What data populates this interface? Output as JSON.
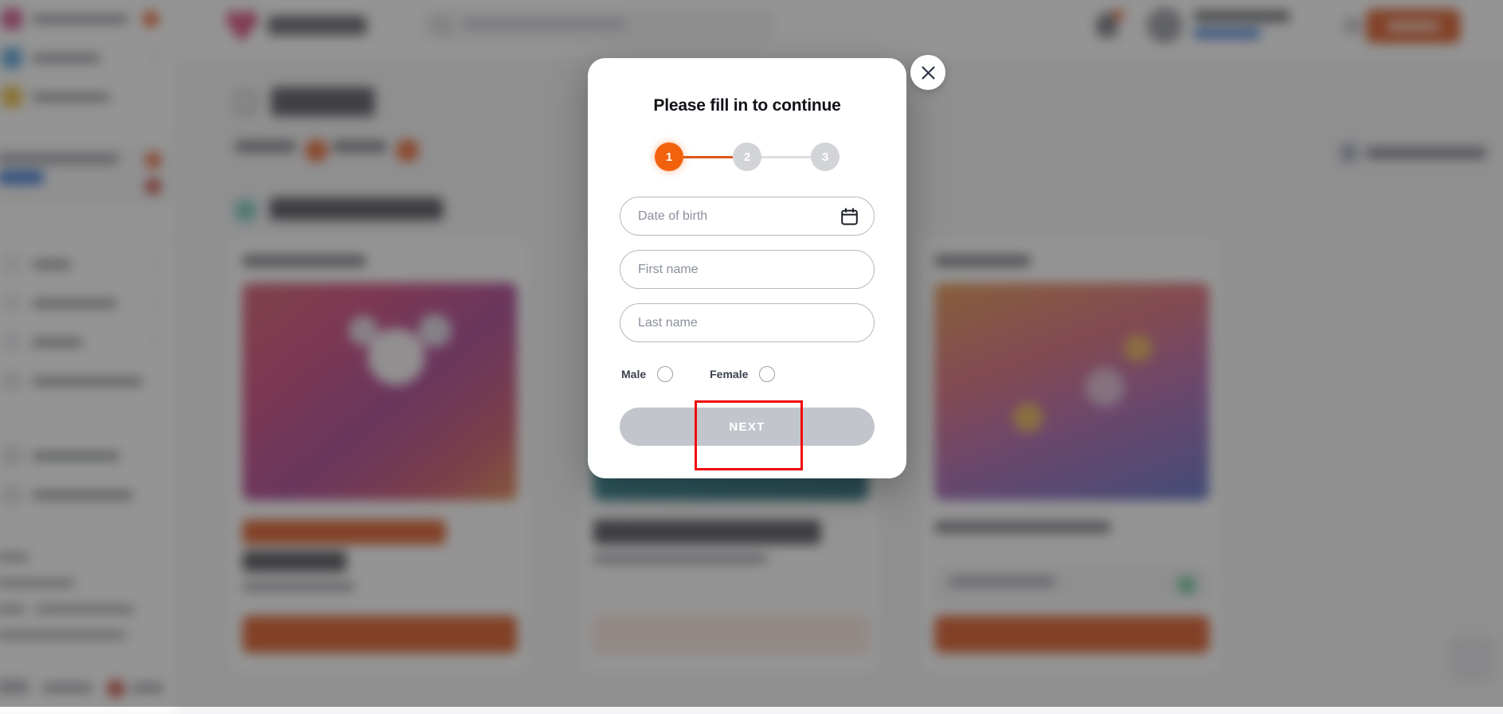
{
  "modal": {
    "title": "Please fill in to continue",
    "close_label": "×",
    "close_icon": "close-icon",
    "steps": [
      {
        "number": "1",
        "state": "active"
      },
      {
        "number": "2",
        "state": "idle"
      },
      {
        "number": "3",
        "state": "idle"
      }
    ],
    "fields": {
      "dob": {
        "placeholder": "Date of birth",
        "value": "",
        "icon": "calendar-icon"
      },
      "first_name": {
        "placeholder": "First name",
        "value": ""
      },
      "last_name": {
        "placeholder": "Last name",
        "value": ""
      }
    },
    "gender": {
      "male_label": "Male",
      "female_label": "Female",
      "selected": ""
    },
    "next_label": "NEXT",
    "next_enabled": false
  },
  "colors": {
    "accent_orange": "#f2610c",
    "cta_orange": "#d8480f",
    "step_idle": "#d3d4d8",
    "next_disabled": "#c3c5cc",
    "annotation_red": "#ef0a0a",
    "title_dark": "#111318",
    "placeholder_gray": "#8a8f9c",
    "scrim": "rgba(60,60,60,0.55)"
  },
  "background": {
    "note": "blurred site content behind the dialog",
    "sidebar_items": [
      {
        "icon": "account-icon",
        "badge": true
      },
      {
        "icon": "wallet-icon",
        "chevron": true
      },
      {
        "icon": "bonus-icon",
        "chevron": false
      }
    ],
    "cards": [
      {
        "image": "bunny-gift-promo"
      },
      {
        "image": "teal-cashback-promo"
      },
      {
        "image": "phone-coins-promo"
      }
    ]
  }
}
